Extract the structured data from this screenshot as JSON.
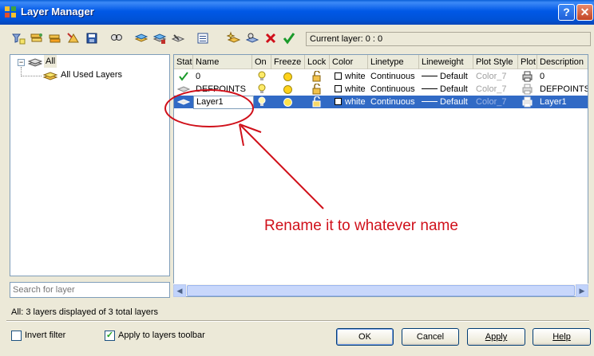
{
  "window": {
    "title": "Layer Manager",
    "help_label": "?",
    "close_label": "✕"
  },
  "toolbar": {
    "tools": [
      "new-filter-icon",
      "group-filter-icon",
      "filter-states-icon",
      "layer-states-icon",
      "save-icon",
      "find-icon",
      "new-layer-icon",
      "new-layer-vp-icon",
      "layer-properties-icon",
      "layer-list-icon",
      "add-layer-icon",
      "layer-settings-icon",
      "delete-layer-icon",
      "set-current-icon"
    ],
    "current_layer": "Current layer: 0 : 0"
  },
  "tree": {
    "root_label": "All",
    "root_expander": "−",
    "child_label": "All Used Layers"
  },
  "search": {
    "placeholder": "Search for layer"
  },
  "grid": {
    "columns": [
      "Stat",
      "Name",
      "On",
      "Freeze",
      "Lock",
      "Color",
      "Linetype",
      "Lineweight",
      "Plot Style",
      "Plot",
      "Description"
    ],
    "rows": [
      {
        "status": "current-check-icon",
        "name": "0",
        "color": "white",
        "linetype": "Continuous",
        "lineweight": "Default",
        "plot_style": "Color_7",
        "description": "0",
        "selected": false
      },
      {
        "status": "layer-icon",
        "name": "DEFPOINTS",
        "color": "white",
        "linetype": "Continuous",
        "lineweight": "Default",
        "plot_style": "Color_7",
        "description": "DEFPOINTS",
        "selected": false
      },
      {
        "status": "layer-icon",
        "name": "Layer1",
        "color": "white",
        "linetype": "Continuous",
        "lineweight": "Default",
        "plot_style": "Color_7",
        "description": "Layer1",
        "selected": true
      }
    ]
  },
  "status_bar": {
    "text": "All: 3 layers displayed of 3 total layers"
  },
  "options": {
    "invert_filter_label": "Invert filter",
    "invert_filter_checked": false,
    "apply_toolbar_label": "Apply to layers toolbar",
    "apply_toolbar_checked": true
  },
  "buttons": {
    "ok": "OK",
    "cancel": "Cancel",
    "apply": "Apply",
    "help": "Help"
  },
  "annotation": {
    "text": "Rename it to whatever name",
    "color": "#d0101a"
  },
  "colors": {
    "title_bar": "#0058e6",
    "selection": "#316ac5",
    "dialog_bg": "#ece9d8"
  }
}
